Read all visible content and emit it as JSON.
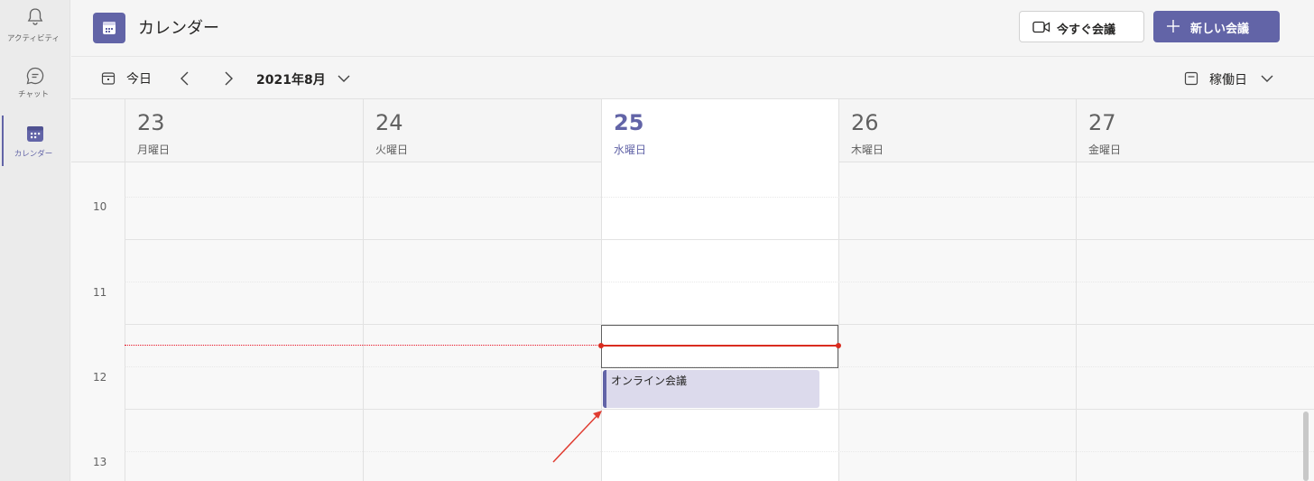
{
  "rail": {
    "items": [
      {
        "label": "アクティビティ",
        "icon": "bell-icon"
      },
      {
        "label": "チャット",
        "icon": "chat-icon"
      },
      {
        "label": "カレンダー",
        "icon": "calendar-icon",
        "active": true
      }
    ]
  },
  "header": {
    "title": "カレンダー",
    "meet_now_label": "今すぐ会議",
    "new_meeting_label": "新しい会議"
  },
  "toolbar": {
    "today_label": "今日",
    "month_label": "2021年8月",
    "view_label": "稼働日"
  },
  "days": [
    {
      "num": "23",
      "name": "月曜日",
      "today": false
    },
    {
      "num": "24",
      "name": "火曜日",
      "today": false
    },
    {
      "num": "25",
      "name": "水曜日",
      "today": true
    },
    {
      "num": "26",
      "name": "木曜日",
      "today": false
    },
    {
      "num": "27",
      "name": "金曜日",
      "today": false
    }
  ],
  "hours": [
    "10",
    "11",
    "12",
    "13"
  ],
  "event": {
    "title": "オンライン会議"
  },
  "colors": {
    "accent": "#6264a7",
    "current_time": "#d92c1f",
    "event_bg": "#dcdaec",
    "annotation_arrow": "#e03c31"
  }
}
